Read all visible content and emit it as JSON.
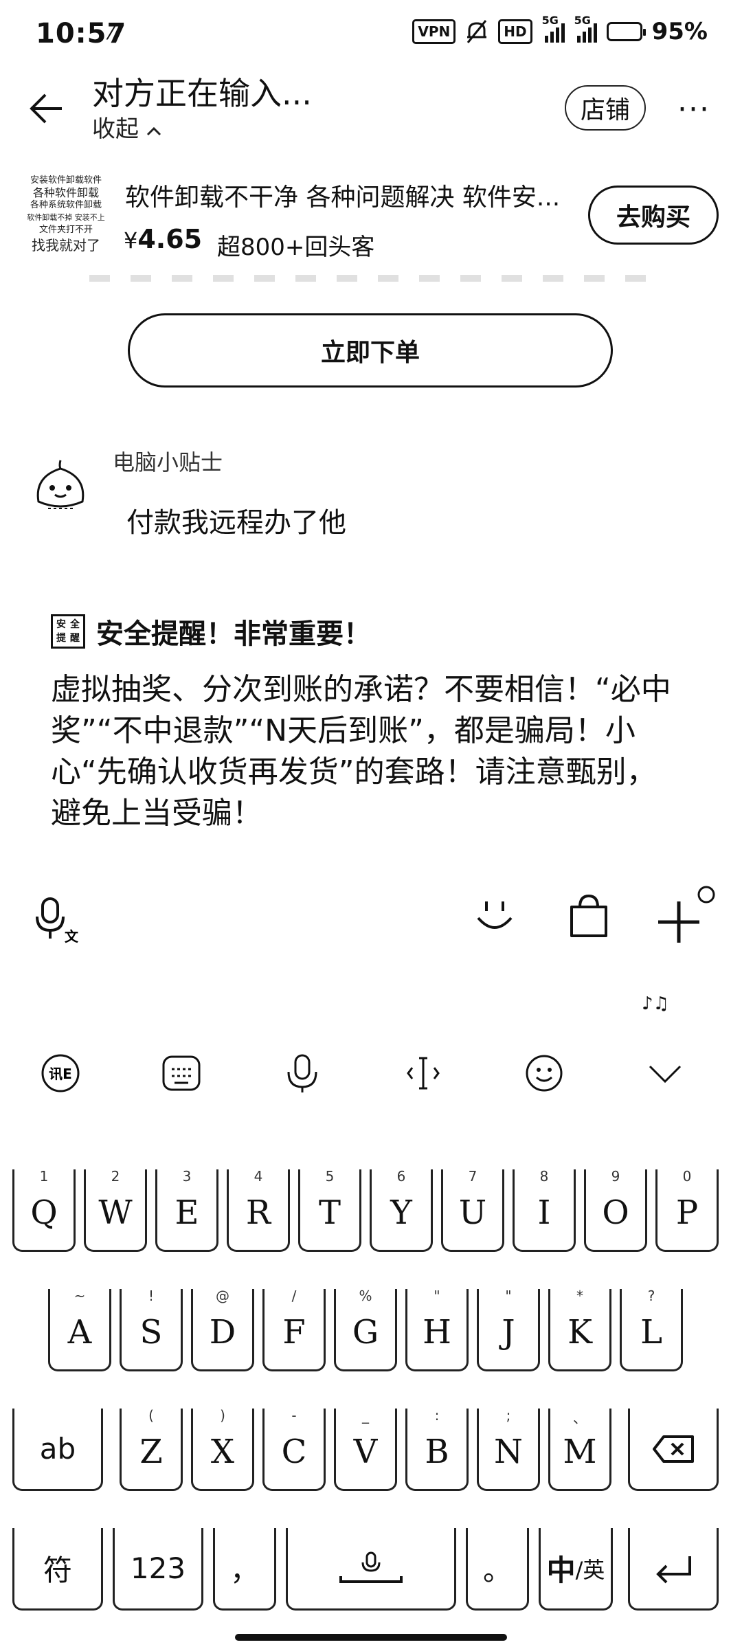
{
  "status_bar": {
    "time": "10:57",
    "vpn": "VPN",
    "hd": "HD",
    "signal_label_1": "5G",
    "signal_label_2": "5G",
    "battery_percent": "95%",
    "battery_level": 0.95
  },
  "header": {
    "title": "对方正在输入...",
    "collapse_label": "收起",
    "shop_label": "店铺",
    "more_label": "···"
  },
  "product": {
    "thumb_lines": [
      "安装软件卸载软件",
      "各种软件卸载",
      "各种系统软件卸载",
      "软件卸载不掉 安装不上",
      "文件夹打不开",
      "找我就对了"
    ],
    "title": "软件卸载不干净 各种问题解决 软件安...",
    "price_symbol": "¥",
    "price": "4.65",
    "repeat_customers": "超800+回头客",
    "buy_label": "去购买"
  },
  "order_button": "立即下单",
  "message": {
    "sender": "电脑小贴士",
    "text": "付款我远程办了他"
  },
  "warning": {
    "icon_chars": [
      "安",
      "全",
      "提",
      "醒"
    ],
    "title": "安全提醒！非常重要！",
    "body": "虚拟抽奖、分次到账的承诺？不要相信！“必中奖”“不中退款”“N天后到账”，都是骗局！小心“先确认收货再发货”的套路！请注意甄别，避免上当受骗！"
  },
  "keyboard": {
    "row1": [
      {
        "hint": "1",
        "key": "Q"
      },
      {
        "hint": "2",
        "key": "W"
      },
      {
        "hint": "3",
        "key": "E"
      },
      {
        "hint": "4",
        "key": "R"
      },
      {
        "hint": "5",
        "key": "T"
      },
      {
        "hint": "6",
        "key": "Y"
      },
      {
        "hint": "7",
        "key": "U"
      },
      {
        "hint": "8",
        "key": "I"
      },
      {
        "hint": "9",
        "key": "O"
      },
      {
        "hint": "0",
        "key": "P"
      }
    ],
    "row2": [
      {
        "hint": "~",
        "key": "A"
      },
      {
        "hint": "!",
        "key": "S"
      },
      {
        "hint": "@",
        "key": "D"
      },
      {
        "hint": "/",
        "key": "F"
      },
      {
        "hint": "%",
        "key": "G"
      },
      {
        "hint": "\"",
        "key": "H"
      },
      {
        "hint": "\"",
        "key": "J"
      },
      {
        "hint": "*",
        "key": "K"
      },
      {
        "hint": "?",
        "key": "L"
      }
    ],
    "row3": [
      {
        "hint": "(",
        "key": "Z"
      },
      {
        "hint": ")",
        "key": "X"
      },
      {
        "hint": "-",
        "key": "C"
      },
      {
        "hint": "_",
        "key": "V"
      },
      {
        "hint": ":",
        "key": "B"
      },
      {
        "hint": ";",
        "key": "N"
      },
      {
        "hint": "、",
        "key": "M"
      }
    ],
    "ab_label": "ab",
    "symbol_label": "符",
    "num_label": "123",
    "comma_label": "，",
    "period_label": "。",
    "lang_cn": "中",
    "lang_en": "/英"
  }
}
